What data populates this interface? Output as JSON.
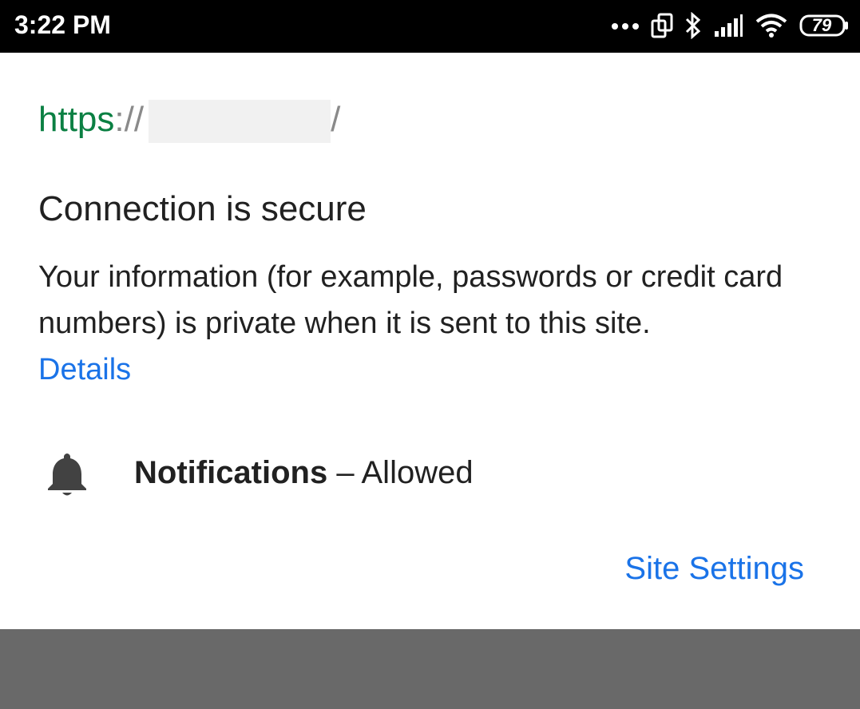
{
  "status_bar": {
    "time": "3:22 PM",
    "battery_level": "79",
    "icons": [
      "more-dots-icon",
      "rotate-icon",
      "bluetooth-icon",
      "signal-icon",
      "wifi-icon",
      "battery-icon"
    ]
  },
  "page_info": {
    "url_scheme": "https",
    "url_separator": "://",
    "url_trailing": "/",
    "title": "Connection is secure",
    "description": "Your information (for example, passwords or credit card numbers) is private when it is sent to this site.",
    "details_link": "Details",
    "permission": {
      "icon": "bell-icon",
      "name": "Notifications",
      "separator": " – ",
      "status": "Allowed"
    },
    "site_settings_label": "Site Settings"
  },
  "colors": {
    "secure_green": "#0b8043",
    "link_blue": "#1a73e8",
    "text": "#212121",
    "scrim": "#696969"
  }
}
